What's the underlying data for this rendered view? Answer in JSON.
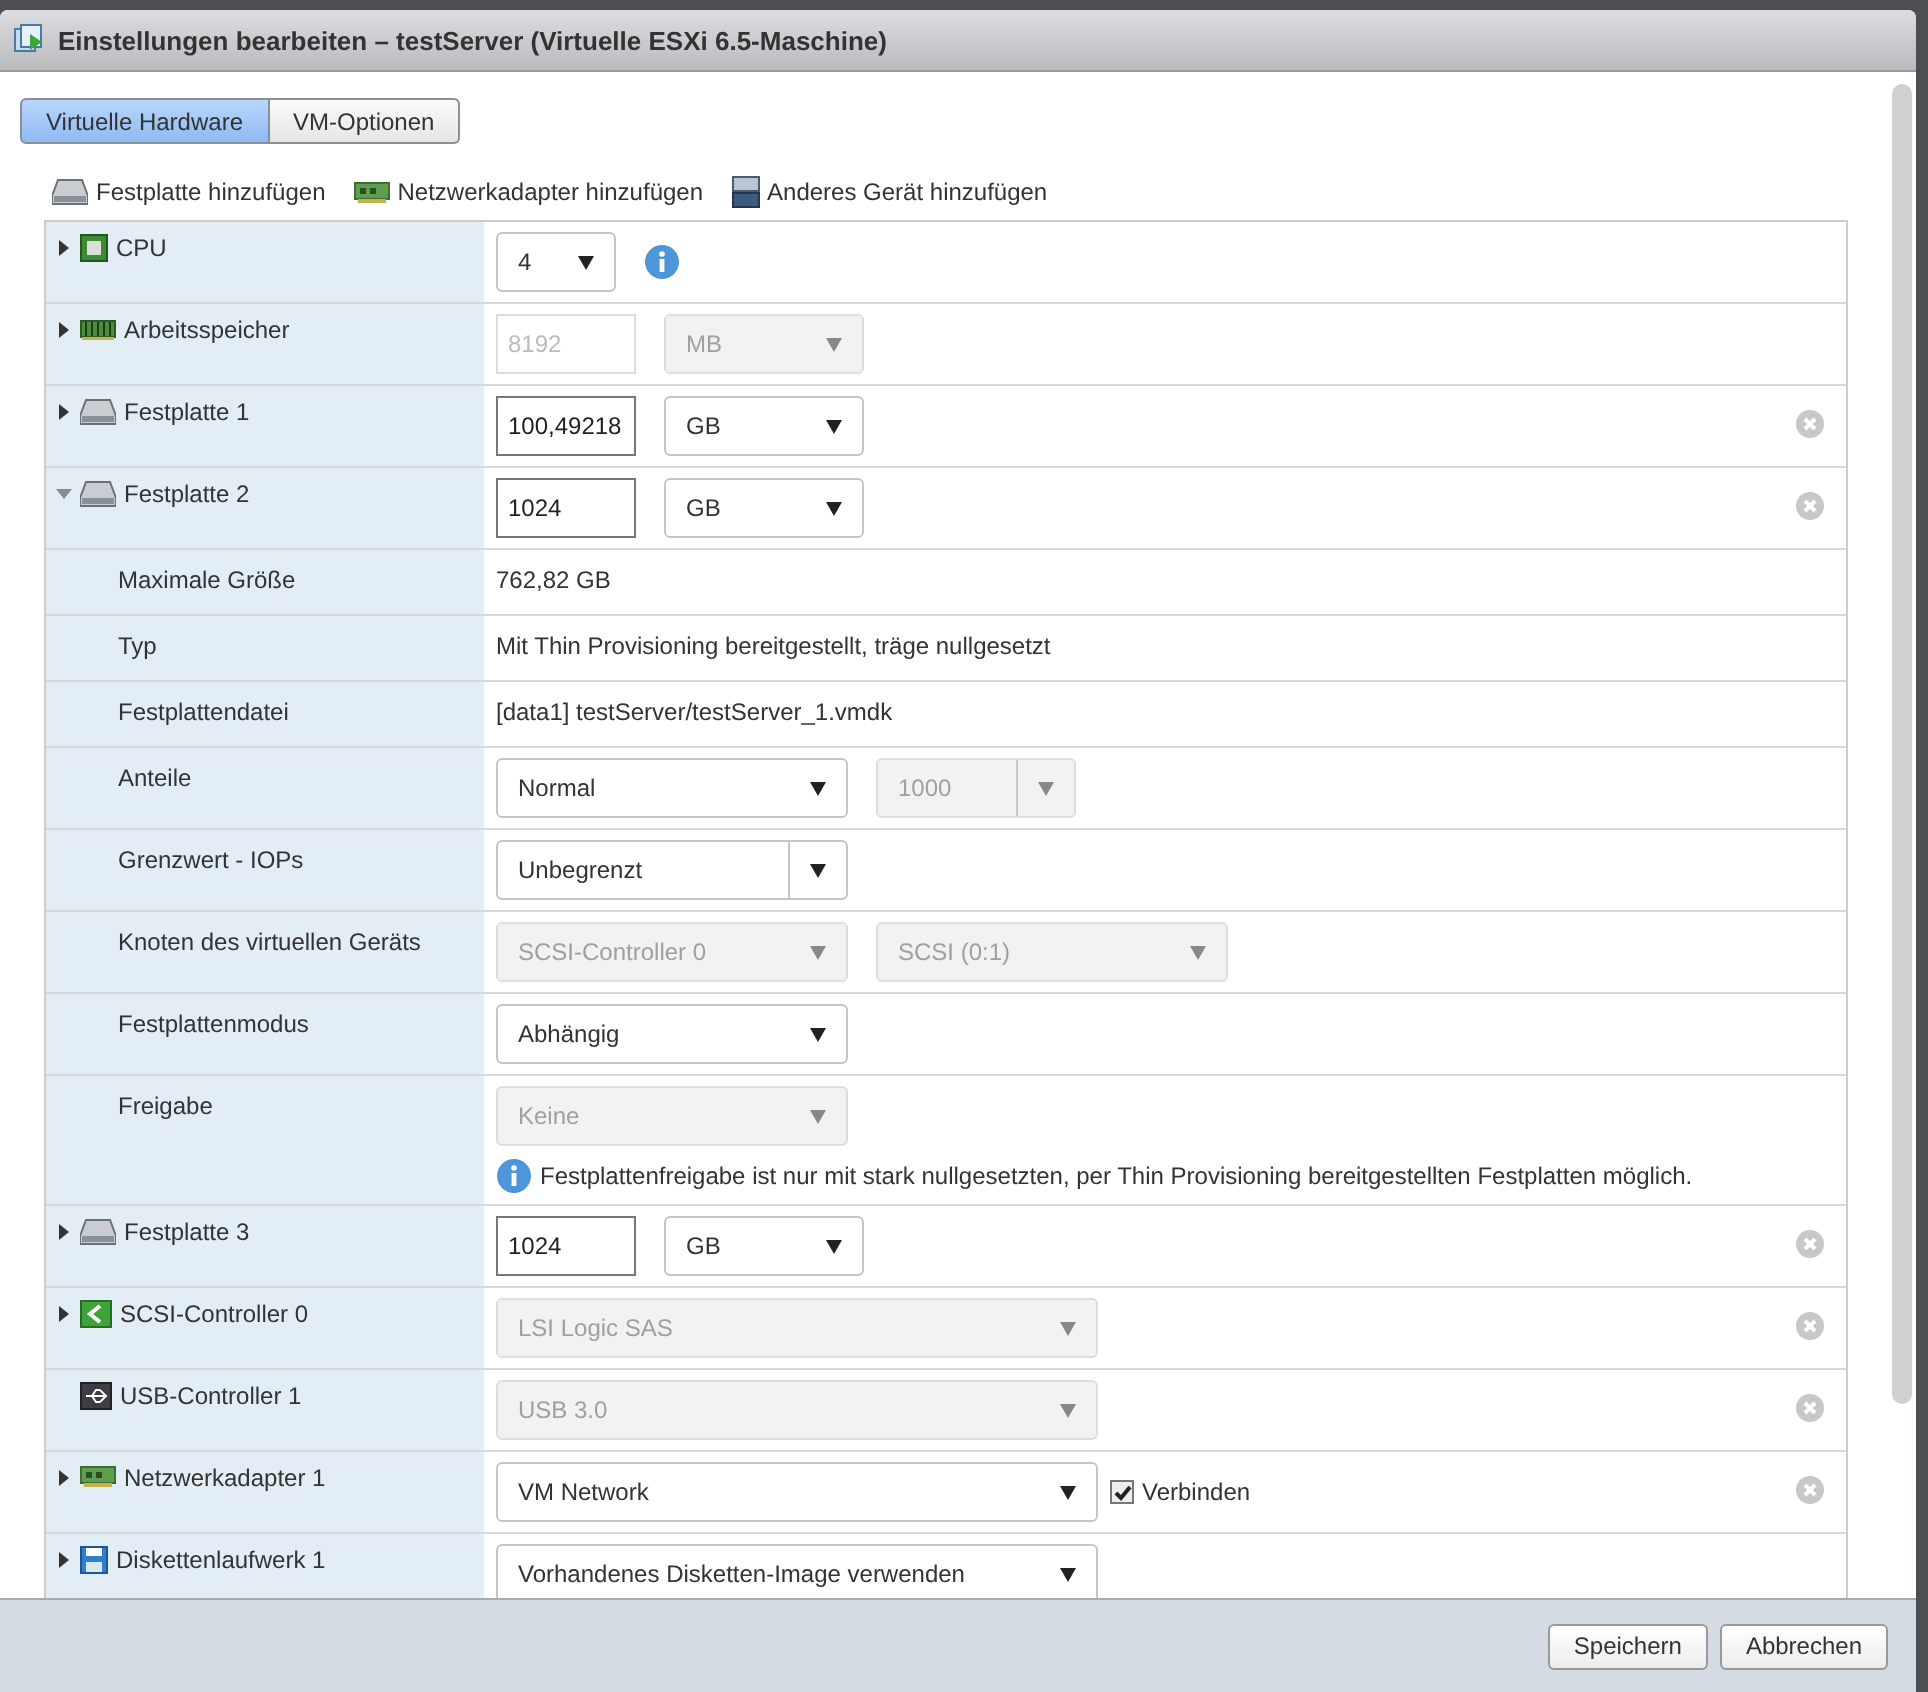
{
  "window": {
    "title": "Einstellungen bearbeiten – testServer (Virtuelle ESXi 6.5-Maschine)"
  },
  "tabs": [
    {
      "label": "Virtuelle Hardware",
      "selected": true
    },
    {
      "label": "VM-Optionen",
      "selected": false
    }
  ],
  "add_actions": [
    {
      "label": "Festplatte hinzufügen",
      "kind": "disk"
    },
    {
      "label": "Netzwerkadapter hinzufügen",
      "kind": "network"
    },
    {
      "label": "Anderes Gerät hinzufügen",
      "kind": "other"
    }
  ],
  "devices": [
    {
      "kind": "cpu",
      "label": "CPU",
      "expandable": true,
      "expanded": false,
      "removable": false,
      "controls": [
        {
          "kind": "count-select",
          "value": "4",
          "disabled": false,
          "split": false
        },
        {
          "kind": "info"
        }
      ]
    },
    {
      "kind": "memory",
      "label": "Arbeitsspeicher",
      "expandable": true,
      "expanded": false,
      "removable": false,
      "controls": [
        {
          "kind": "input",
          "value": "8192",
          "disabled": true
        },
        {
          "kind": "unit-select",
          "value": "MB",
          "disabled": true,
          "split": false
        }
      ]
    },
    {
      "kind": "disk",
      "label": "Festplatte 1",
      "expandable": true,
      "expanded": false,
      "removable": true,
      "controls": [
        {
          "kind": "input",
          "value": "100,49218",
          "disabled": false
        },
        {
          "kind": "unit-select",
          "value": "GB",
          "disabled": false,
          "split": false
        }
      ]
    },
    {
      "kind": "disk",
      "label": "Festplatte 2",
      "expandable": true,
      "expanded": true,
      "removable": true,
      "controls": [
        {
          "kind": "input",
          "value": "1024",
          "disabled": false
        },
        {
          "kind": "unit-select",
          "value": "GB",
          "disabled": false,
          "split": false
        }
      ],
      "children": [
        {
          "label": "Maximale Größe",
          "controls": [
            {
              "kind": "text",
              "value": "762,82 GB"
            }
          ]
        },
        {
          "label": "Typ",
          "controls": [
            {
              "kind": "text",
              "value": "Mit Thin Provisioning bereitgestellt, träge nullgesetzt"
            }
          ]
        },
        {
          "label": "Festplattendatei",
          "controls": [
            {
              "kind": "text",
              "value": "[data1] testServer/testServer_1.vmdk"
            }
          ]
        },
        {
          "label": "Anteile",
          "controls": [
            {
              "kind": "select",
              "value": "Normal",
              "disabled": false,
              "split": false
            },
            {
              "kind": "unit-select",
              "value": "1000",
              "disabled": true,
              "split": true
            }
          ]
        },
        {
          "label": "Grenzwert - IOPs",
          "controls": [
            {
              "kind": "select",
              "value": "Unbegrenzt",
              "disabled": false,
              "split": true
            }
          ]
        },
        {
          "label": "Knoten des virtuellen Geräts",
          "controls": [
            {
              "kind": "select",
              "value": "SCSI-Controller 0",
              "disabled": true,
              "split": false
            },
            {
              "kind": "select",
              "value": "SCSI (0:1)",
              "disabled": true,
              "split": false
            }
          ]
        },
        {
          "label": "Festplattenmodus",
          "controls": [
            {
              "kind": "select",
              "value": "Abhängig",
              "disabled": false,
              "split": false
            }
          ]
        },
        {
          "label": "Freigabe",
          "controls": [
            {
              "kind": "select",
              "value": "Keine",
              "disabled": true,
              "split": false
            }
          ],
          "note": "Festplattenfreigabe ist nur mit stark nullgesetzten, per Thin Provisioning bereitgestellten Festplatten möglich."
        }
      ]
    },
    {
      "kind": "disk",
      "label": "Festplatte 3",
      "expandable": true,
      "expanded": false,
      "removable": true,
      "controls": [
        {
          "kind": "input",
          "value": "1024",
          "disabled": false
        },
        {
          "kind": "unit-select",
          "value": "GB",
          "disabled": false,
          "split": false
        }
      ]
    },
    {
      "kind": "controller",
      "label": "SCSI-Controller 0",
      "expandable": true,
      "expanded": false,
      "removable": true,
      "controls": [
        {
          "kind": "wide-select",
          "value": "LSI Logic SAS",
          "disabled": true,
          "split": false
        }
      ]
    },
    {
      "kind": "usb",
      "label": "USB-Controller 1",
      "expandable": false,
      "removable": true,
      "controls": [
        {
          "kind": "wide-select",
          "value": "USB 3.0",
          "disabled": true,
          "split": false
        }
      ]
    },
    {
      "kind": "network",
      "label": "Netzwerkadapter 1",
      "expandable": true,
      "expanded": false,
      "removable": true,
      "controls": [
        {
          "kind": "wide-select",
          "value": "VM Network",
          "disabled": false,
          "split": false
        },
        {
          "kind": "checkbox",
          "label": "Verbinden",
          "checked": true
        }
      ]
    },
    {
      "kind": "floppy",
      "label": "Diskettenlaufwerk 1",
      "expandable": true,
      "expanded": false,
      "removable": false,
      "controls": [
        {
          "kind": "wide-select",
          "value": "Vorhandenes Disketten-Image verwenden",
          "disabled": false,
          "split": false
        }
      ]
    }
  ],
  "buttons": [
    {
      "label": "Speichern"
    },
    {
      "label": "Abbrechen"
    }
  ]
}
